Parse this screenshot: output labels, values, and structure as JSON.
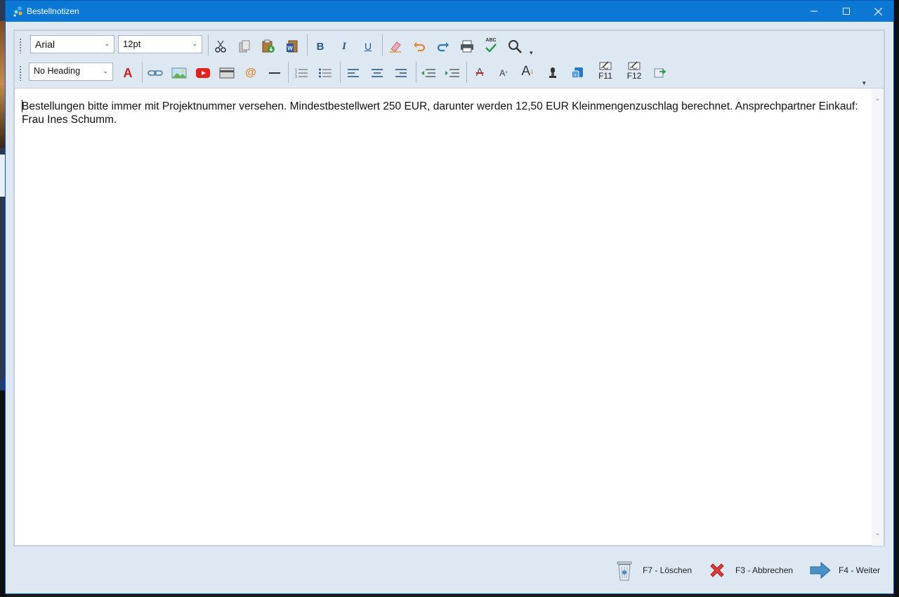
{
  "window": {
    "title": "Bestellnotizen",
    "accent_color": "#0a78d4"
  },
  "toolbar1": {
    "font_family": "Arial",
    "font_size": "12pt",
    "icons": [
      "cut-icon",
      "copy-icon",
      "paste-icon",
      "paste-word-icon",
      "bold-icon",
      "italic-icon",
      "underline-icon",
      "clear-format-icon",
      "undo-icon",
      "redo-icon",
      "print-icon",
      "spellcheck-icon",
      "search-icon"
    ],
    "bold_label": "B",
    "italic_label": "I",
    "underline_label": "U",
    "spell_label": "ABC"
  },
  "toolbar2": {
    "heading": "No Heading",
    "font_color_label": "A",
    "strike_label": "A",
    "superscript_label": "A",
    "superscript_mark": "+",
    "fontsize_label": "A",
    "fontsize_mark": "1",
    "f11_label": "F11",
    "f12_label": "F12"
  },
  "editor": {
    "text": "Bestellungen bitte immer mit Projektnummer versehen. Mindestbestellwert 250 EUR, darunter werden 12,50 EUR Kleinmengenzuschlag berechnet. Ansprechpartner Einkauf: Frau Ines Schumm."
  },
  "footer": {
    "delete_label": "F7 - Löschen",
    "cancel_label": "F3 - Abbrechen",
    "next_label": "F4 - Weiter"
  }
}
